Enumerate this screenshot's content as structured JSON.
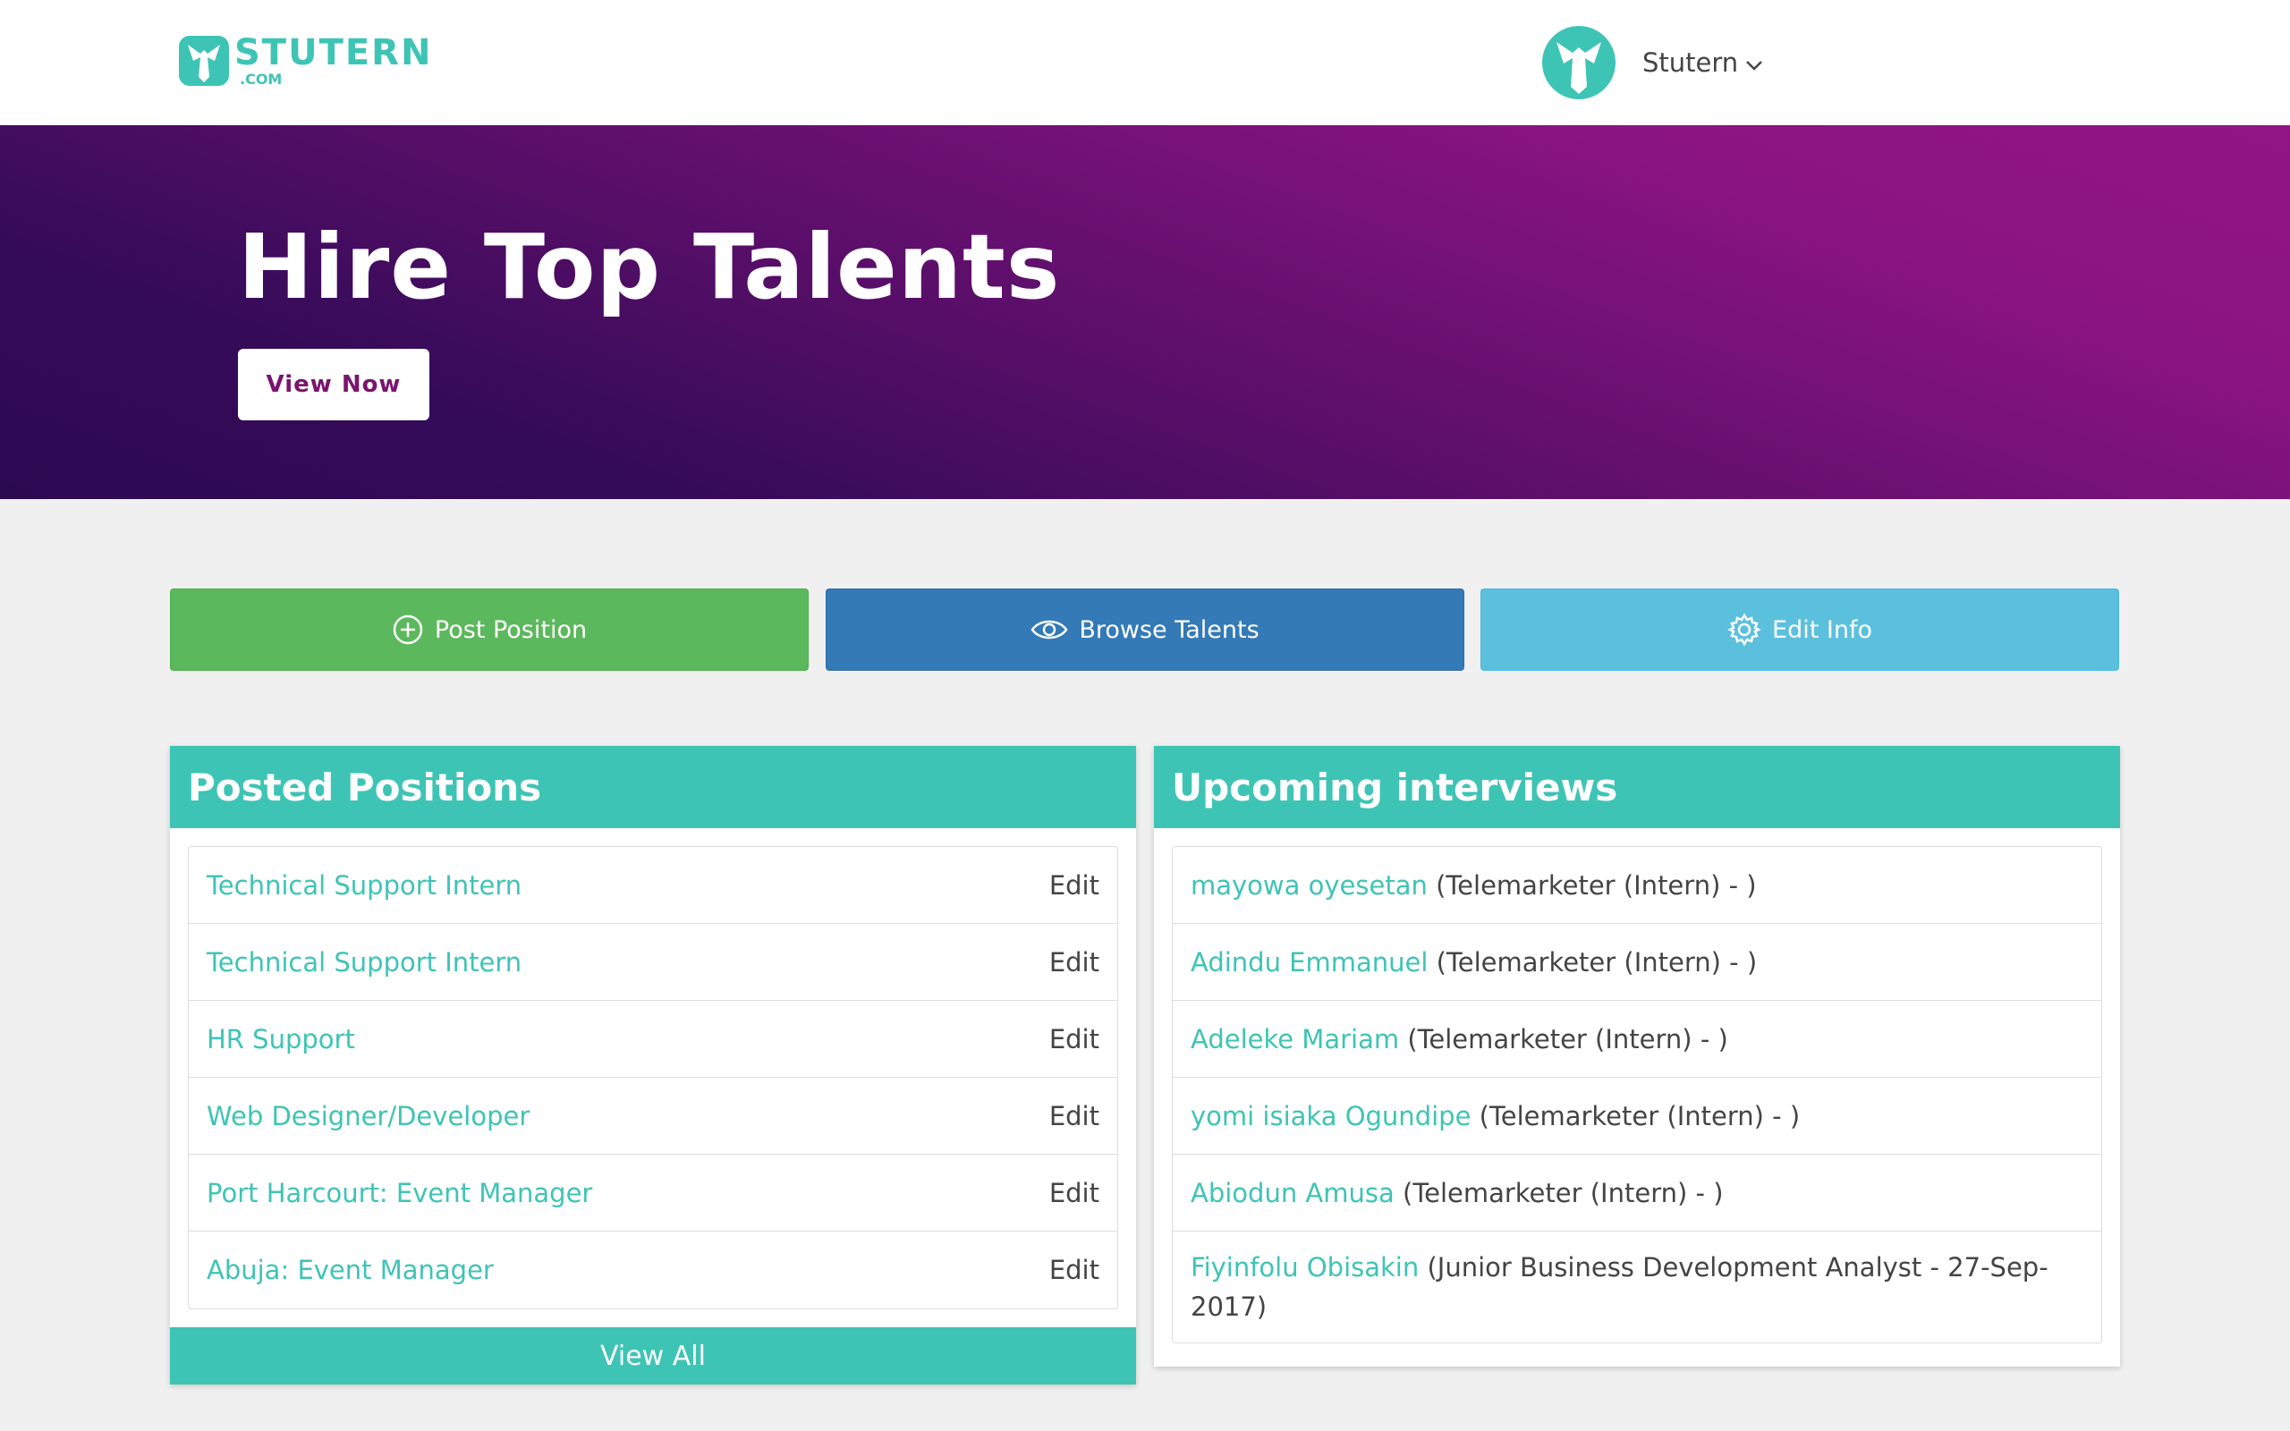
{
  "header": {
    "logo_word": "STUTERN",
    "logo_sub": ".COM",
    "user_name": "Stutern"
  },
  "hero": {
    "title": "Hire Top Talents",
    "button": "View Now"
  },
  "actions": {
    "post": "Post Position",
    "browse": "Browse Talents",
    "edit": "Edit Info"
  },
  "posted": {
    "title": "Posted Positions",
    "edit_label": "Edit",
    "view_all": "View All",
    "items": [
      "Technical Support Intern",
      "Technical Support Intern",
      "HR Support",
      "Web Designer/Developer",
      "Port Harcourt: Event Manager",
      "Abuja: Event Manager"
    ]
  },
  "interviews": {
    "title": "Upcoming interviews",
    "items": [
      {
        "name": "mayowa oyesetan",
        "detail": "(Telemarketer (Intern) - )"
      },
      {
        "name": "Adindu Emmanuel",
        "detail": "(Telemarketer (Intern) - )"
      },
      {
        "name": "Adeleke Mariam",
        "detail": "(Telemarketer (Intern) - )"
      },
      {
        "name": "yomi isiaka Ogundipe",
        "detail": "(Telemarketer (Intern) - )"
      },
      {
        "name": "Abiodun Amusa",
        "detail": "(Telemarketer (Intern) - )"
      },
      {
        "name": "Fiyinfolu Obisakin",
        "detail": "(Junior Business Development Analyst - 27-Sep-2017)"
      }
    ]
  },
  "colors": {
    "accent": "#3ec4b5",
    "success": "#5cb85c",
    "primary": "#337ab7",
    "info": "#5bc0de",
    "hero_start": "#2c0a52",
    "hero_end": "#911585"
  }
}
